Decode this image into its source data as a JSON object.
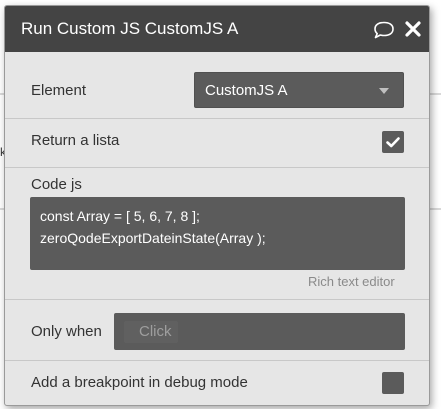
{
  "dialog": {
    "title": "Run Custom JS CustomJS A",
    "comment_icon": "speech-bubble-icon",
    "close_icon": "close-icon"
  },
  "element": {
    "label": "Element",
    "selected": "CustomJS A"
  },
  "return_list": {
    "label": "Return a lista",
    "checked": true
  },
  "code": {
    "label": "Code js",
    "lines": [
      "const Array = [ 5, 6, 7, 8 ];",
      "zeroQodeExportDateinState(Array );"
    ],
    "hint": "Rich text editor"
  },
  "only_when": {
    "label": "Only when",
    "placeholder": "Click"
  },
  "breakpoint": {
    "label": "Add a breakpoint in debug mode",
    "checked": false
  },
  "colors": {
    "titlebar": "#444444",
    "panel": "#e6e6e6",
    "field": "#5b5b5b"
  }
}
